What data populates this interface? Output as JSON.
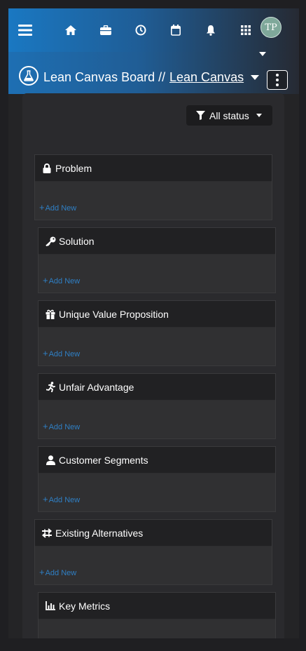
{
  "header": {
    "icons": [
      "menu-icon",
      "home-icon",
      "briefcase-icon",
      "clock-icon",
      "calendar-icon",
      "bell-icon",
      "apps-grid-icon"
    ],
    "avatar_initials": "TP"
  },
  "titlebar": {
    "title": "Lean Canvas Board //",
    "link": "Lean Canvas"
  },
  "filter": {
    "label": "All status"
  },
  "sections": [
    {
      "title": "Problem",
      "icon": "lock-icon",
      "add_label": "Add New"
    },
    {
      "title": "Solution",
      "icon": "key-icon",
      "add_label": "Add New"
    },
    {
      "title": "Unique Value Proposition",
      "icon": "gift-icon",
      "add_label": "Add New"
    },
    {
      "title": "Unfair Advantage",
      "icon": "running-person-icon",
      "add_label": "Add New"
    },
    {
      "title": "Customer Segments",
      "icon": "user-icon",
      "add_label": "Add New"
    },
    {
      "title": "Existing Alternatives",
      "icon": "arrows-swap-icon",
      "add_label": "Add New"
    },
    {
      "title": "Key Metrics",
      "icon": "chart-icon",
      "add_label": "Add New"
    }
  ]
}
